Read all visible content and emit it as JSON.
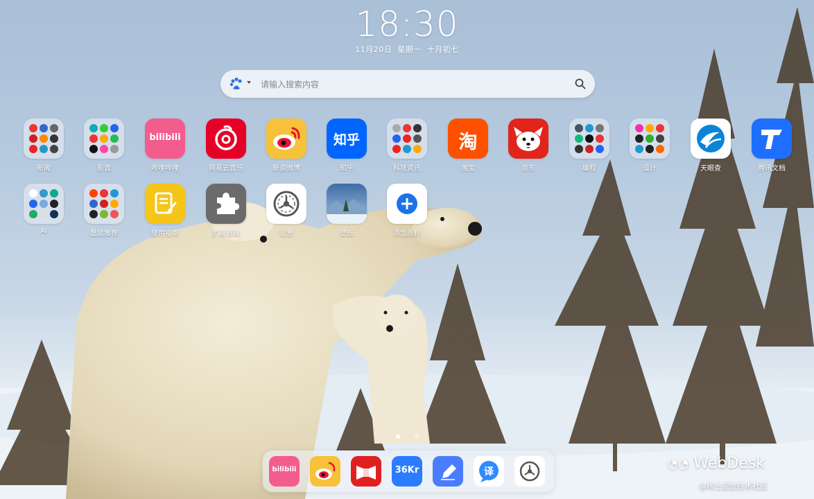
{
  "clock": {
    "time": "18:30",
    "date": "11月20日",
    "weekday": "星期一",
    "lunar": "十月初七"
  },
  "search": {
    "placeholder": "请输入搜索内容",
    "engine_icon": "baidu-paw-icon",
    "search_icon": "search-icon"
  },
  "apps": [
    {
      "label": "新闻",
      "type": "folder"
    },
    {
      "label": "影音",
      "type": "folder"
    },
    {
      "label": "哔哩哔哩",
      "type": "app",
      "color": "#f25d8e",
      "glyph": "bilibili"
    },
    {
      "label": "网易云音乐",
      "type": "app",
      "color": "#e60026",
      "glyph": "netease-music-icon"
    },
    {
      "label": "新浪微博",
      "type": "app",
      "color": "#f7c23a",
      "glyph": "weibo-icon"
    },
    {
      "label": "知乎",
      "type": "app",
      "color": "#0066ff",
      "glyph": "知乎"
    },
    {
      "label": "科技资讯",
      "type": "folder"
    },
    {
      "label": "淘宝",
      "type": "app",
      "color": "#ff5000",
      "glyph": "淘"
    },
    {
      "label": "京东",
      "type": "app",
      "color": "#e1251b",
      "glyph": "jd-dog-icon"
    },
    {
      "label": "编程",
      "type": "folder"
    },
    {
      "label": "设计",
      "type": "folder"
    },
    {
      "label": "天眼查",
      "type": "app",
      "color": "#ffffff",
      "glyph": "tianyancha-icon"
    },
    {
      "label": "腾讯文档",
      "type": "app",
      "color": "#1e6fff",
      "glyph": "tencent-docs-icon"
    },
    {
      "label": "AI",
      "type": "folder"
    },
    {
      "label": "酷站推荐",
      "type": "folder"
    },
    {
      "label": "使用指南",
      "type": "app",
      "color": "#f5c518",
      "glyph": "guide-icon"
    },
    {
      "label": "扩展管理",
      "type": "app",
      "color": "#6b6b6b",
      "glyph": "puzzle-icon"
    },
    {
      "label": "设置",
      "type": "app",
      "color": "#ffffff",
      "glyph": "gear-icon"
    },
    {
      "label": "壁纸",
      "type": "app",
      "color": "#5b84b8",
      "glyph": "wallpaper-icon"
    },
    {
      "label": "添加图标",
      "type": "app",
      "color": "#ffffff",
      "glyph": "plus-icon"
    }
  ],
  "dock": [
    {
      "name": "bilibili-icon",
      "color": "#f25d8e"
    },
    {
      "name": "weibo-icon",
      "color": "#f7c23a"
    },
    {
      "name": "red-panel-icon",
      "color": "#e02020"
    },
    {
      "name": "36kr-icon",
      "color": "#2b7cff",
      "text": "36Kr"
    },
    {
      "name": "pen-note-icon",
      "color": "#4a7cff"
    },
    {
      "name": "translate-icon",
      "color": "#ffffff",
      "text": "译"
    },
    {
      "name": "gear-icon",
      "color": "#ffffff"
    }
  ],
  "watermark": {
    "brand": "WebDesk",
    "sub": "@稀土掘金技术社区"
  },
  "colors": {
    "accent": "#1a73e8",
    "label_text": "#ffffff"
  }
}
